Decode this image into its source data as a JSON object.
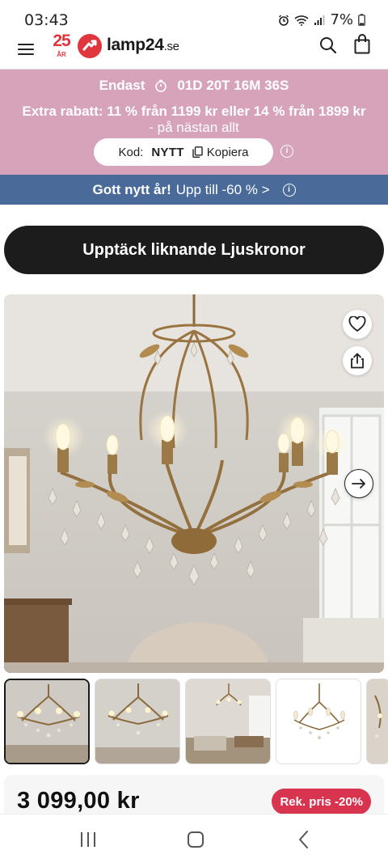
{
  "status_bar": {
    "time": "03:43",
    "battery": "7%"
  },
  "header": {
    "anniversary_number": "25",
    "anniversary_label": "ÅR",
    "logo_name": "lamp24",
    "logo_tld": ".se"
  },
  "promo": {
    "only_label": "Endast",
    "countdown": "01D 20T 16M 36S",
    "discount_line": "Extra rabatt: 11 % från 1199 kr eller 14 % från 1899 kr",
    "discount_sub": "- på nästan allt",
    "code_label": "Kod:",
    "code_value": "NYTT",
    "copy_label": "Kopiera",
    "info_glyph": "i"
  },
  "new_year_bar": {
    "strong": "Gott nytt år!",
    "text": "Upp till -60 % >",
    "info_glyph": "i"
  },
  "cta": {
    "label": "Upptäck liknande Ljuskronor"
  },
  "gallery": {
    "thumbnail_count": 5,
    "active_index": 0
  },
  "product": {
    "price": "3 099,00 kr",
    "badge": "Rek. pris -20%"
  },
  "colors": {
    "brand": "#e0363d",
    "promo_bg": "#d6a3bb",
    "new_year_bg": "#4a6b9a",
    "cta_bg": "#1c1c1c",
    "badge_bg": "#d8344f"
  }
}
